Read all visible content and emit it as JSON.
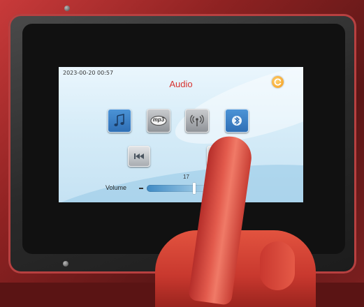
{
  "status": {
    "datetime": "2023-00-20  00:57"
  },
  "header": {
    "title": "Audio",
    "refresh_icon": "refresh-icon"
  },
  "sources": [
    {
      "icon": "music-note-icon",
      "active": true
    },
    {
      "icon": "mp3-icon",
      "label": "mp3",
      "active": false
    },
    {
      "icon": "radio-antenna-icon",
      "active": false
    },
    {
      "icon": "bluetooth-icon",
      "active": true
    }
  ],
  "nav": {
    "prev_icon": "skip-previous-icon",
    "next_icon": "fast-forward-icon"
  },
  "volume": {
    "label": "Volume",
    "value": "17",
    "minus_icon": "minus-icon"
  },
  "colors": {
    "title": "#d8322f",
    "active_button": "#3b80c6",
    "refresh": "#f39a17"
  }
}
